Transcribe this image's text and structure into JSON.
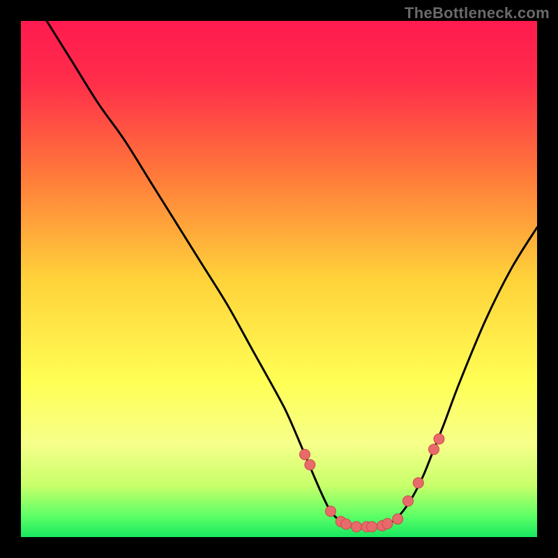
{
  "watermark": "TheBottleneck.com",
  "colors": {
    "page_bg": "#000000",
    "gradient_stops": [
      {
        "pct": 0,
        "color": "#ff1a4f"
      },
      {
        "pct": 12,
        "color": "#ff2e4a"
      },
      {
        "pct": 30,
        "color": "#ff7a3a"
      },
      {
        "pct": 50,
        "color": "#ffd23a"
      },
      {
        "pct": 70,
        "color": "#ffff55"
      },
      {
        "pct": 82,
        "color": "#f6ff8a"
      },
      {
        "pct": 90,
        "color": "#c8ff6a"
      },
      {
        "pct": 96,
        "color": "#5bff66"
      },
      {
        "pct": 100,
        "color": "#18e860"
      }
    ],
    "curve": "#000000",
    "dot_fill": "#e96a6a",
    "dot_stroke": "#c84a4a"
  },
  "chart_data": {
    "type": "line",
    "title": "",
    "xlabel": "",
    "ylabel": "",
    "xlim": [
      0,
      100
    ],
    "ylim": [
      0,
      100
    ],
    "series": [
      {
        "name": "bottleneck-curve",
        "x": [
          5,
          10,
          15,
          20,
          25,
          30,
          35,
          40,
          45,
          50,
          52,
          55,
          58,
          60,
          62,
          63,
          65,
          68,
          70,
          72,
          74,
          76,
          78,
          80,
          82,
          85,
          90,
          95,
          100
        ],
        "values": [
          100,
          92,
          84,
          77,
          69,
          61,
          53,
          45,
          36,
          27,
          23,
          16,
          9,
          5,
          3,
          2.5,
          2,
          2,
          2.2,
          3,
          5,
          8,
          12,
          17,
          22,
          30,
          42,
          52,
          60
        ]
      }
    ],
    "markers": {
      "name": "highlight-dots",
      "x": [
        55,
        56,
        60,
        62,
        63,
        65,
        67,
        68,
        70,
        71,
        73,
        75,
        77,
        80,
        81
      ],
      "values": [
        16,
        14,
        5,
        3,
        2.5,
        2,
        2,
        2,
        2.2,
        2.6,
        3.5,
        7,
        10.5,
        17,
        19
      ]
    }
  }
}
